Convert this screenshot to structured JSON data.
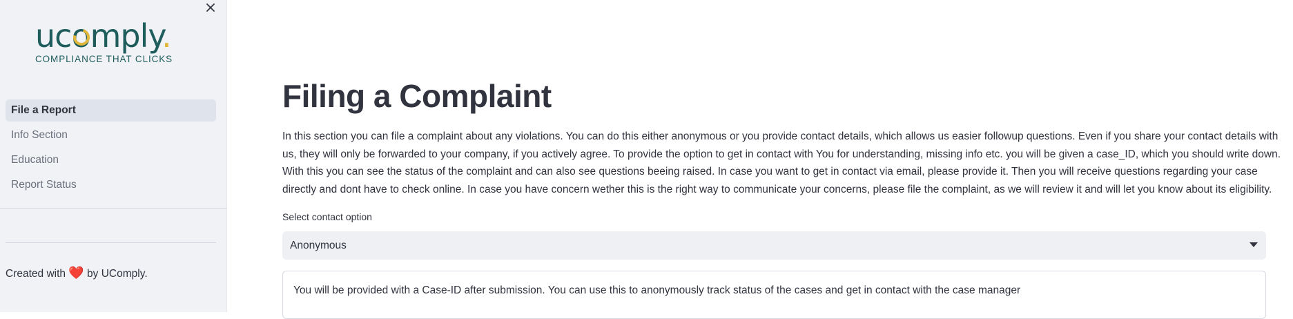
{
  "sidebar": {
    "logo": {
      "word_pre": "uc",
      "word_o": "o",
      "word_post": "mply",
      "word_dot": ".",
      "tagline": "COMPLIANCE THAT CLICKS"
    },
    "close_icon": "×",
    "items": [
      {
        "label": "File a Report",
        "active": true
      },
      {
        "label": "Info Section",
        "active": false
      },
      {
        "label": "Education",
        "active": false
      },
      {
        "label": "Report Status",
        "active": false
      }
    ],
    "credit": {
      "pre": "Created with ",
      "heart": "❤️",
      "post": " by UComply."
    }
  },
  "main": {
    "title": "Filing a Complaint",
    "intro": "In this section you can file a complaint about any violations. You can do this either anonymous or you provide contact details, which allows us easier followup questions. Even if you share your contact details with us, they will only be forwarded to your company, if you actively agree. To provide the option to get in contact with You for understanding, missing info etc. you will be given a case_ID, which you should write down. With this you can see the status of the complaint and can also see questions beeing raised. In case you want to get in contact via email, please provide it. Then you will receive questions regarding your case directly and dont have to check online. In case you have concern wether this is the right way to communicate your concerns, please file the complaint, as we will review it and will let you know about its eligibility.",
    "contact_select": {
      "label": "Select contact option",
      "value": "Anonymous"
    },
    "info_box": "You will be provided with a Case-ID after submission. You can use this to anonymously track status of the cases and get in contact with the case manager"
  },
  "colors": {
    "brand_teal": "#1f5c5c",
    "brand_gold": "#e0b73a",
    "sidebar_bg": "#f0f2f6",
    "heart_red": "#e0252c"
  }
}
